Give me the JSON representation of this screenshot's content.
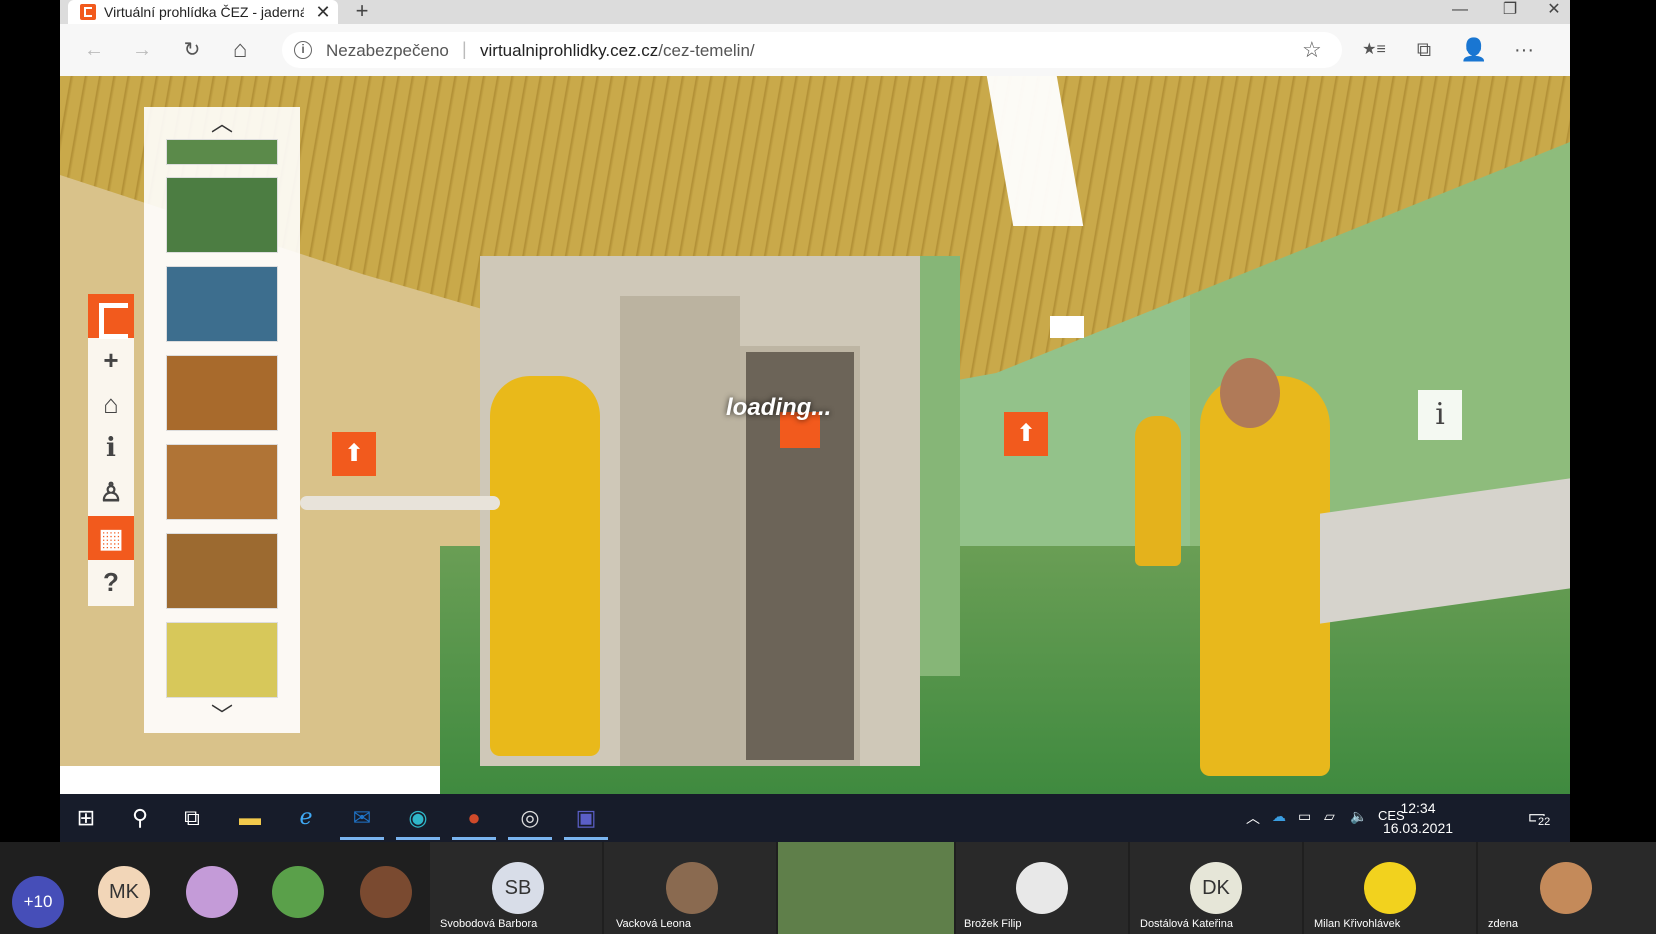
{
  "browser": {
    "tab_title": "Virtuální prohlídka ČEZ - jaderná",
    "tab_close": "✕",
    "new_tab": "+",
    "window_controls": {
      "minimize": "—",
      "maximize": "❐",
      "close": "✕"
    },
    "nav": {
      "back": "←",
      "forward": "→",
      "reload": "↻",
      "home": "⌂"
    },
    "address": {
      "security_label": "Nezabezpečeno",
      "separator": "|",
      "url_host": "virtualniprohlidky.cez.cz",
      "url_path": "/cez-temelin/"
    },
    "toolbar_icons": {
      "star": "☆",
      "favorites": "★≡",
      "collections": "⧉",
      "profile": "👤",
      "menu": "···"
    }
  },
  "tour": {
    "loading_text": "loading...",
    "side_buttons": [
      {
        "name": "cez-logo",
        "glyph": ""
      },
      {
        "name": "zoom-in",
        "glyph": "+"
      },
      {
        "name": "home",
        "glyph": "⌂"
      },
      {
        "name": "info",
        "glyph": "i"
      },
      {
        "name": "person",
        "glyph": "♙"
      },
      {
        "name": "thumbnails",
        "glyph": "▦"
      },
      {
        "name": "help",
        "glyph": "?"
      }
    ],
    "thumbnail_up": "︿",
    "thumbnail_down": "﹀",
    "hotspot_glyph": "⬆",
    "info_hotspot": "i",
    "thumbnail_colors": [
      "#5b8a4a",
      "#4c7d42",
      "#3d6e8e",
      "#a86a2c",
      "#b07436",
      "#9c6a30",
      "#d7c85a"
    ]
  },
  "taskbar": {
    "start": "⊞",
    "search": "⚲",
    "taskview": "⧉",
    "tray_language": "CES",
    "time": "12:34",
    "date": "16.03.2021",
    "notifications": "22"
  },
  "meeting": {
    "more_count": "+10",
    "participants": [
      {
        "initials": "MK",
        "name": "",
        "color": "#f2d6b8"
      },
      {
        "initials": "",
        "name": "",
        "color": "#c49bd8"
      },
      {
        "initials": "",
        "name": "",
        "color": "#5aa04a"
      },
      {
        "initials": "",
        "name": "",
        "color": "#7a4a30"
      },
      {
        "initials": "SB",
        "name": "Svobodová Barbora",
        "color": "#d8dde8"
      },
      {
        "initials": "",
        "name": "Vacková Leona",
        "color": "#8a6a50"
      },
      {
        "initials": "",
        "name": "",
        "color": "#6b8a4a"
      },
      {
        "initials": "",
        "name": "Brožek Filip",
        "color": "#e8e8e8"
      },
      {
        "initials": "DK",
        "name": "Dostálová Kateřina",
        "color": "#e6e6d8"
      },
      {
        "initials": "",
        "name": "Milan Křivohlávek",
        "color": "#f2d21e"
      },
      {
        "initials": "",
        "name": "zdena",
        "color": "#c48a5a"
      }
    ]
  }
}
